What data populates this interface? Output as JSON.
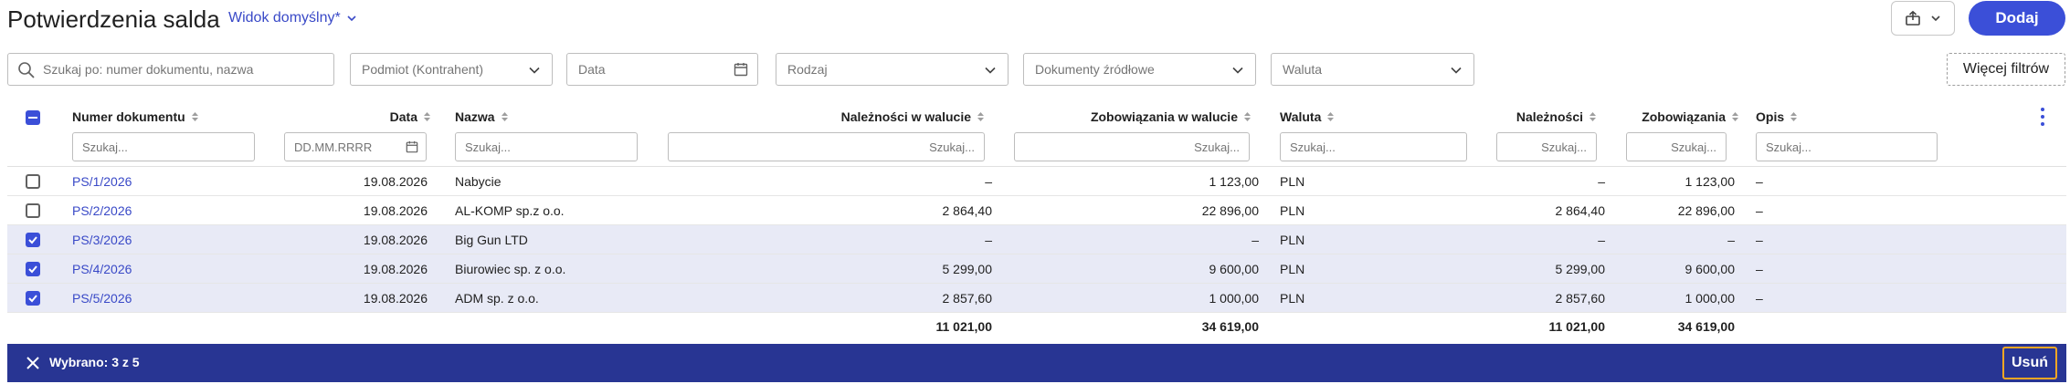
{
  "header": {
    "title": "Potwierdzenia salda",
    "view": "Widok domyślny*",
    "add_label": "Dodaj"
  },
  "filters": {
    "search_placeholder": "Szukaj po: numer dokumentu, nazwa",
    "subject": "Podmiot (Kontrahent)",
    "date": "Data",
    "kind": "Rodzaj",
    "source_docs": "Dokumenty źródłowe",
    "currency": "Waluta",
    "more_label": "Więcej filtrów"
  },
  "columns": {
    "number": "Numer dokumentu",
    "date": "Data",
    "name": "Nazwa",
    "receivables_cur": "Należności w walucie",
    "liabilities_cur": "Zobowiązania w walucie",
    "currency": "Waluta",
    "receivables": "Należności",
    "liabilities": "Zobowiązania",
    "description": "Opis"
  },
  "column_search": {
    "placeholder": "Szukaj...",
    "date_placeholder": "DD.MM.RRRR"
  },
  "rows": [
    {
      "number": "PS/1/2026",
      "date": "19.08.2026",
      "name": "Nabycie",
      "receivables_cur": "–",
      "liabilities_cur": "1 123,00",
      "currency": "PLN",
      "receivables": "–",
      "liabilities": "1 123,00",
      "description": "–",
      "checked": false
    },
    {
      "number": "PS/2/2026",
      "date": "19.08.2026",
      "name": "AL-KOMP sp.z o.o.",
      "receivables_cur": "2 864,40",
      "liabilities_cur": "22 896,00",
      "currency": "PLN",
      "receivables": "2 864,40",
      "liabilities": "22 896,00",
      "description": "–",
      "checked": false
    },
    {
      "number": "PS/3/2026",
      "date": "19.08.2026",
      "name": "Big Gun LTD",
      "receivables_cur": "–",
      "liabilities_cur": "–",
      "currency": "PLN",
      "receivables": "–",
      "liabilities": "–",
      "description": "–",
      "checked": true
    },
    {
      "number": "PS/4/2026",
      "date": "19.08.2026",
      "name": "Biurowiec sp. z o.o.",
      "receivables_cur": "5 299,00",
      "liabilities_cur": "9 600,00",
      "currency": "PLN",
      "receivables": "5 299,00",
      "liabilities": "9 600,00",
      "description": "–",
      "checked": true
    },
    {
      "number": "PS/5/2026",
      "date": "19.08.2026",
      "name": "ADM sp. z o.o.",
      "receivables_cur": "2 857,60",
      "liabilities_cur": "1 000,00",
      "currency": "PLN",
      "receivables": "2 857,60",
      "liabilities": "1 000,00",
      "description": "–",
      "checked": true
    }
  ],
  "totals": {
    "receivables_cur": "11 021,00",
    "liabilities_cur": "34 619,00",
    "receivables": "11 021,00",
    "liabilities": "34 619,00"
  },
  "selection_bar": {
    "count": "Wybrano: 3 z 5",
    "delete_label": "Usuń"
  },
  "colors": {
    "accent": "#3b4fd8",
    "selection_bar": "#283593",
    "selected_row": "#e8eaf6",
    "highlight_border": "#f5a623"
  }
}
